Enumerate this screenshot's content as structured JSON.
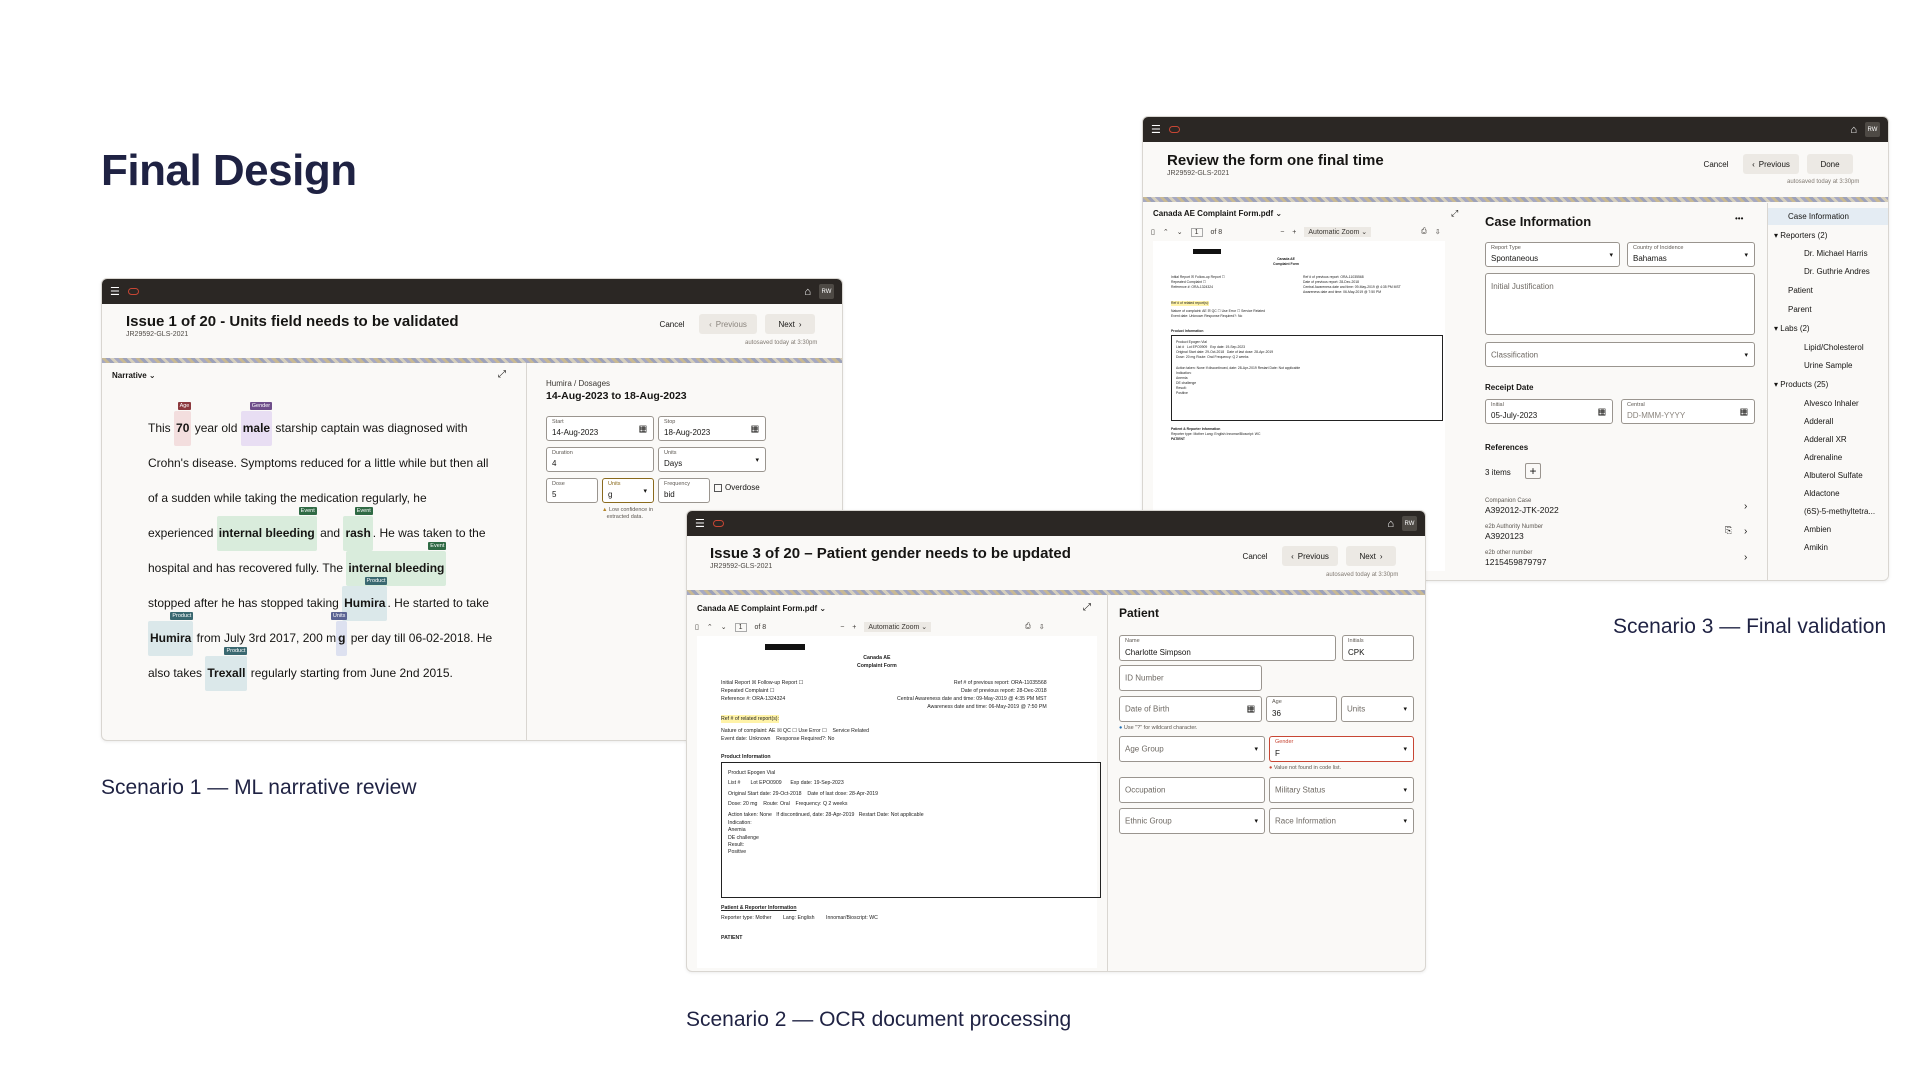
{
  "page": {
    "title": "Final Design",
    "captions": {
      "s1": "Scenario 1 — ML narrative review",
      "s2": "Scenario 2 — OCR document processing",
      "s3": "Scenario 3 — Final validation"
    }
  },
  "common": {
    "avatar": "RW",
    "cancel": "Cancel",
    "previous": "Previous",
    "next": "Next",
    "done": "Done",
    "autosaved": "autosaved today at 3:30pm",
    "pdf_name": "Canada AE Complaint Form.pdf",
    "page_num": "1",
    "page_of": "of 8",
    "zoom": "Automatic Zoom"
  },
  "s1": {
    "title": "Issue 1 of 20 - Units field needs to be validated",
    "case_id": "JR29592-GLS-2021",
    "panel": "Narrative",
    "narr": {
      "t1": "This ",
      "age": "70",
      "age_tag": "Age",
      "t2": " year old ",
      "male": "male",
      "male_tag": "Gender",
      "t3": " starship captain was diagnosed with",
      "l2": "Crohn's disease. Symptoms reduced for a little while but then all",
      "l3": "of a sudden while taking the medication regularly, he",
      "l4a": "experienced ",
      "ib1": "internal bleeding",
      "ev": "Event",
      "l4b": " and ",
      "rash": "rash",
      "l4c": ". He was taken to the",
      "l5a": "hospital and has recovered fully. The ",
      "ib2": "internal bleeding",
      "l6a": "stopped after he has stopped taking ",
      "humira": "Humira",
      "prod": "Product",
      "l6b": ". He started to take",
      "l7a": " from July 3rd 2017, 200 m",
      "g": "g",
      "units_tag": "Units",
      "l7b": " per day till 06-02-2018. He",
      "l8a": "also takes ",
      "trexall": "Trexall",
      "l8b": " regularly starting from June 2nd 2015."
    },
    "breadcrumb": "Humira / Dosages",
    "range": "14-Aug-2023 to 18-Aug-2023",
    "fields": {
      "start_l": "Start",
      "start_v": "14-Aug-2023",
      "stop_l": "Stop",
      "stop_v": "18-Aug-2023",
      "duration_l": "Duration",
      "duration_v": "4",
      "units_l": "Units",
      "units_v": "Days",
      "dose_l": "Dose",
      "dose_v": "5",
      "units2_l": "Units",
      "units2_v": "g",
      "freq_l": "Frequency",
      "freq_v": "bid",
      "overdose": "Overdose",
      "warn1": "Low confidence in",
      "warn2": "extracted data."
    }
  },
  "s2": {
    "title": "Issue 3 of 20 – Patient gender needs to be updated",
    "case_id": "JR29592-GLS-2021",
    "section": "Patient",
    "fields": {
      "name_l": "Name",
      "name_v": "Charlotte Simpson",
      "initials_l": "Initials",
      "initials_v": "CPK",
      "id": "ID Number",
      "dob": "Date of Birth",
      "age_l": "Age",
      "age_v": "36",
      "units": "Units",
      "hint": "Use \"?\" for wildcard character.",
      "age_group": "Age Group",
      "gender_l": "Gender",
      "gender_v": "F",
      "gender_err": "Value not found in code list.",
      "occupation": "Occupation",
      "military": "Military Status",
      "ethnic": "Ethnic Group",
      "race": "Race Information"
    }
  },
  "doc": {
    "title1": "Canada AE",
    "title2": "Complaint Form",
    "initial_report": "Initial Report",
    "followup": "Follow-up Report",
    "repeated": "Repeated Complaint",
    "reference": "Reference #:",
    "ref_val": "ORA-1324324",
    "prev_ref": "Ref # of previous report:",
    "prev_ref_val": "ORA-11035568",
    "prev_date": "Date of previous report:",
    "prev_date_val": "28-Dec-2018",
    "cad": "Central Awareness date and time:",
    "cad_val": "09-May-2019 @ 4:35 PM MST",
    "aware": "Awareness date and time:",
    "aware_val": "06-May-2019 @ 7:50 PM",
    "related": "Ref # of related report(s):",
    "nature": "Nature of complaint:",
    "ae": "AE",
    "qc": "QC",
    "use_err": "Use Error",
    "svc": "Service Related",
    "event_date": "Event date:",
    "unknown": "Unknown",
    "resp": "Response Required?:",
    "no": "No",
    "pinfo": "Product Information",
    "product": "Product",
    "product_v": "Epogen Vial",
    "list": "List #",
    "lot": "Lot",
    "lot_v": "EPO0909",
    "exp": "Exp date:",
    "exp_v": "19-Sep-2023",
    "orig": "Original Start date:",
    "orig_v": "29-Oct-2018",
    "last": "Date of last dose:",
    "last_v": "28-Apr-2019",
    "dose": "Dose:",
    "dose_v": "20 mg",
    "route": "Route:",
    "route_v": "Oral",
    "freq": "Frequency:",
    "freq_v": "Q 2 weeks",
    "action": "Action taken:",
    "action_v": "None",
    "discont": "If discontinued, date:",
    "discont_v": "28-Apr-2019",
    "restart": "Restart Date:",
    "restart_v": "Not applicable",
    "indication": "Indication:",
    "anemia": "Anemia",
    "de": "DE challenge",
    "result": "Result:",
    "positive": "Positive",
    "pri": "Patient & Reporter Information",
    "reporter": "Reporter type:",
    "reporter_v": "Mother",
    "lang": "Lang:",
    "lang_v": "English",
    "innomar": "Innomar/Bioscript:",
    "innomar_v": "WC",
    "patient": "PATIENT"
  },
  "s3": {
    "title": "Review the form one final time",
    "case_id": "JR29592-GLS-2021",
    "section": "Case Information",
    "more": "•••",
    "fields": {
      "report_type_l": "Report Type",
      "report_type_v": "Spontaneous",
      "country_l": "Country of Incidence",
      "country_v": "Bahamas",
      "justification": "Initial Justification",
      "classification": "Classification",
      "receipt": "Receipt Date",
      "initial_l": "Initial",
      "initial_v": "05-July-2023",
      "central_l": "Central",
      "central_p": "DD-MMM-YYYY",
      "references": "References",
      "items": "3 items",
      "ref1_l": "Companion Case",
      "ref1_v": "A392012-JTK-2022",
      "ref2_l": "e2b Authority Number",
      "ref2_v": "A3920123",
      "ref3_l": "e2b other number",
      "ref3_v": "1215459879797"
    },
    "tree": {
      "case_info": "Case Information",
      "reporters": "Reporters (2)",
      "r1": "Dr. Michael Harris",
      "r2": "Dr. Guthrie Andres",
      "patient": "Patient",
      "parent": "Parent",
      "labs": "Labs (2)",
      "l1": "Lipid/Cholesterol",
      "l2": "Urine Sample",
      "products": "Products (25)",
      "p1": "Alvesco Inhaler",
      "p2": "Adderall",
      "p3": "Adderall XR",
      "p4": "Adrenaline",
      "p5": "Albuterol Sulfate",
      "p6": "Aldactone",
      "p7": "(6S)-5-methyltetra...",
      "p8": "Ambien",
      "p9": "Amikin"
    }
  },
  "colors": {
    "heading": "#1f2243",
    "topbar": "#2b2724",
    "brand": "#c74634",
    "error": "#c74634"
  }
}
